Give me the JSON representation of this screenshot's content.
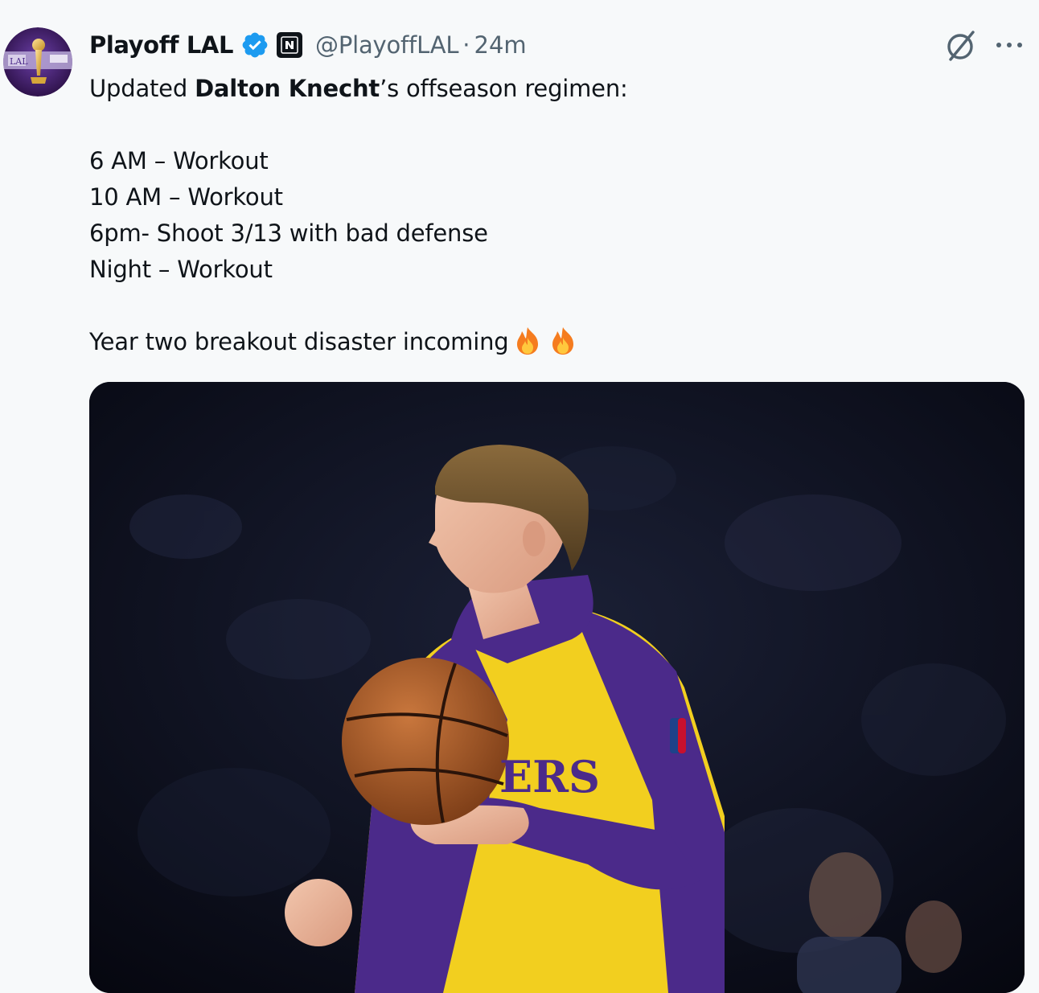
{
  "author": {
    "display_name": "Playoff LAL",
    "verified_icon": "verified-badge-icon",
    "affiliate_icon": "affiliate-badge-icon",
    "handle": "@PlayoffLAL",
    "separator": "·",
    "time": "24m"
  },
  "actions": {
    "grok_icon": "grok-icon",
    "more_icon": "more-icon"
  },
  "post": {
    "intro_prefix": "Updated ",
    "intro_bold": "Dalton Knecht",
    "intro_suffix": "’s offseason regimen:",
    "schedule": [
      "6 AM – Workout",
      "10 AM – Workout",
      "6pm- Shoot 3/13 with bad defense",
      "Night – Workout"
    ],
    "closing": "Year two breakout disaster incoming",
    "emojis": [
      "fire-emoji",
      "fire-emoji"
    ]
  },
  "media": {
    "type": "photo",
    "subject": "basketball player in purple and gold warm-up jacket holding a basketball",
    "jersey_text": "ERS"
  },
  "colors": {
    "background": "#f7f9fa",
    "text": "#0f1419",
    "secondary_text": "#536471",
    "verified_blue": "#1d9bf0",
    "lakers_purple": "#4b2a8a",
    "lakers_gold": "#f2cf1f"
  }
}
